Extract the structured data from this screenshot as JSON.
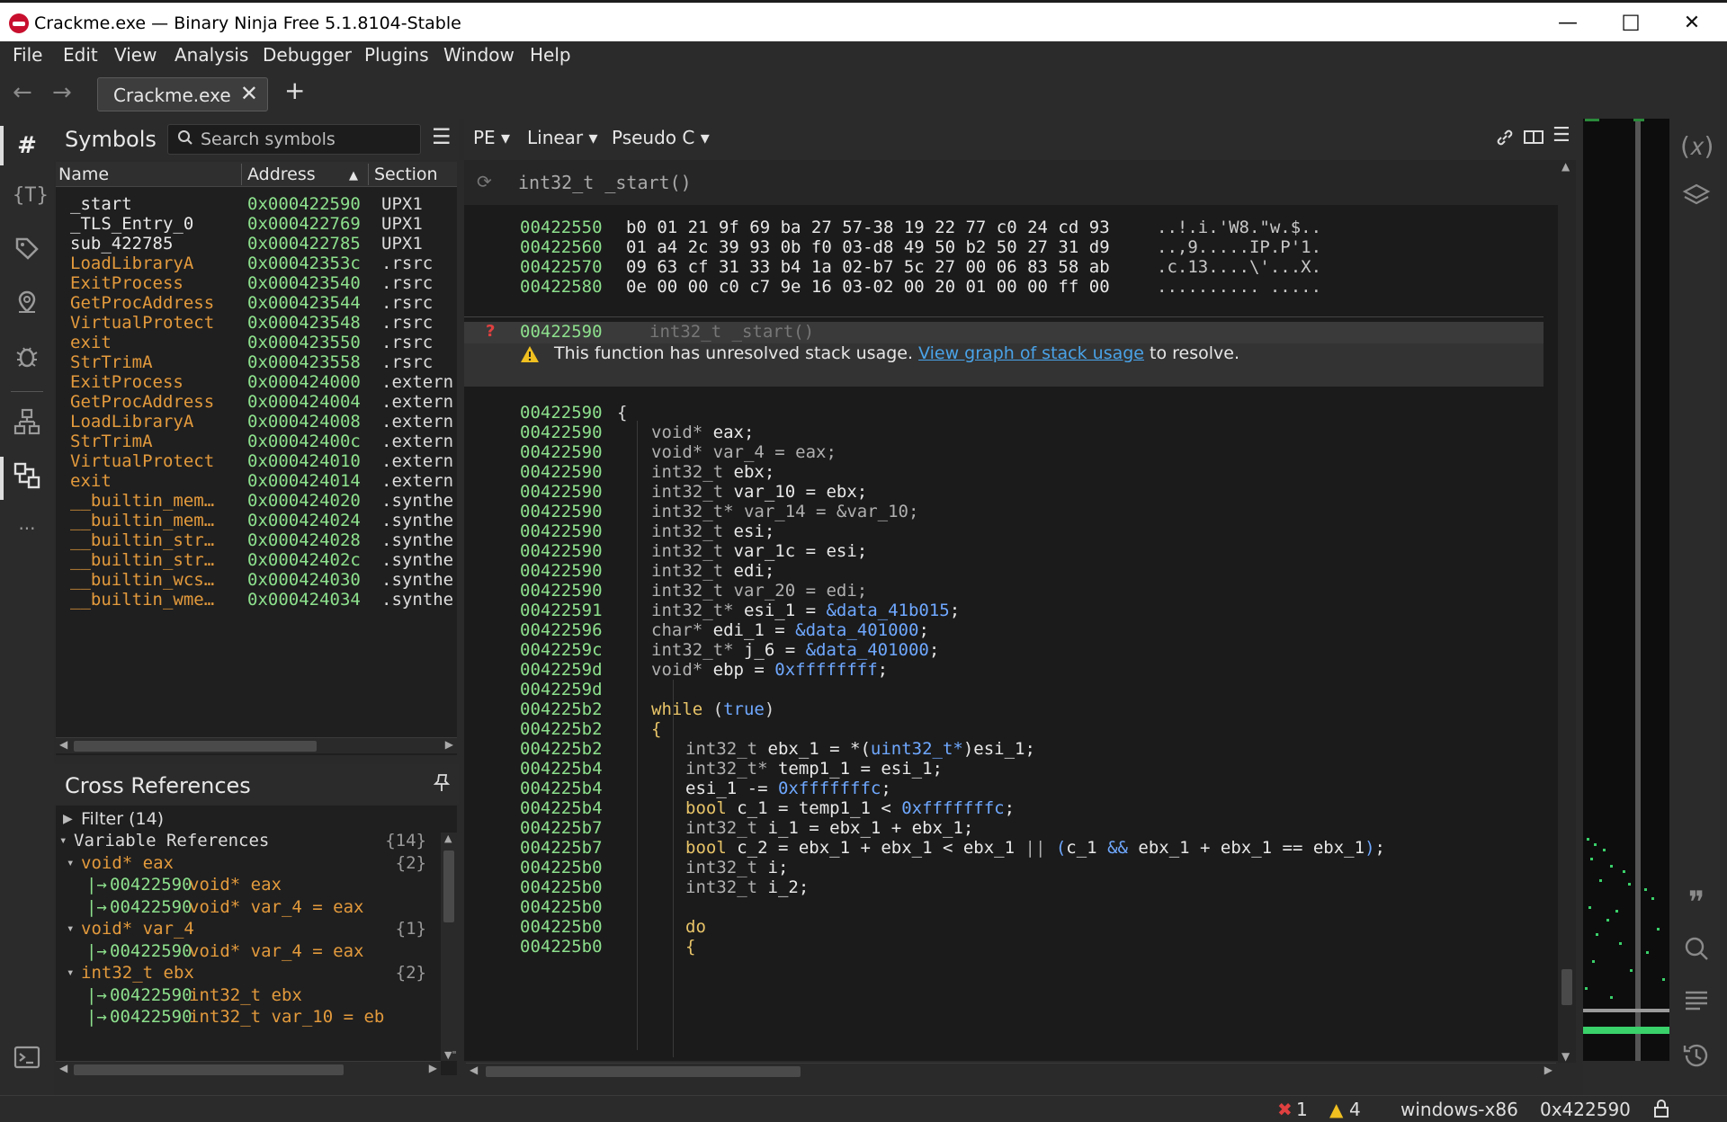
{
  "window": {
    "title": "Crackme.exe — Binary Ninja Free 5.1.8104-Stable",
    "minimize": "—",
    "maximize": "☐",
    "close": "✕"
  },
  "menu": [
    "File",
    "Edit",
    "View",
    "Analysis",
    "Debugger",
    "Plugins",
    "Window",
    "Help"
  ],
  "tabs": {
    "back": "←",
    "forward": "→",
    "active": "Crackme.exe",
    "close": "✕",
    "new": "+"
  },
  "symbols": {
    "title": "Symbols",
    "search_placeholder": "Search symbols",
    "columns": {
      "name": "Name",
      "address": "Address",
      "sort_indicator": "▲",
      "section": "Section"
    },
    "rows": [
      {
        "name": "_start",
        "address": "0x000422590",
        "section": "UPX1",
        "color": "#e8e8e8"
      },
      {
        "name": "_TLS_Entry_0",
        "address": "0x000422769",
        "section": "UPX1",
        "color": "#e8e8e8"
      },
      {
        "name": "sub_422785",
        "address": "0x000422785",
        "section": "UPX1",
        "color": "#e8e8e8"
      },
      {
        "name": "LoadLibraryA",
        "address": "0x00042353c",
        "section": ".rsrc",
        "color": "#e39a3c"
      },
      {
        "name": "ExitProcess",
        "address": "0x000423540",
        "section": ".rsrc",
        "color": "#e39a3c"
      },
      {
        "name": "GetProcAddress",
        "address": "0x000423544",
        "section": ".rsrc",
        "color": "#e39a3c"
      },
      {
        "name": "VirtualProtect",
        "address": "0x000423548",
        "section": ".rsrc",
        "color": "#e39a3c"
      },
      {
        "name": "exit",
        "address": "0x000423550",
        "section": ".rsrc",
        "color": "#e39a3c"
      },
      {
        "name": "StrTrimA",
        "address": "0x000423558",
        "section": ".rsrc",
        "color": "#e39a3c"
      },
      {
        "name": "ExitProcess",
        "address": "0x000424000",
        "section": ".extern",
        "color": "#e39a3c"
      },
      {
        "name": "GetProcAddress",
        "address": "0x000424004",
        "section": ".extern",
        "color": "#e39a3c"
      },
      {
        "name": "LoadLibraryA",
        "address": "0x000424008",
        "section": ".extern",
        "color": "#e39a3c"
      },
      {
        "name": "StrTrimA",
        "address": "0x00042400c",
        "section": ".extern",
        "color": "#e39a3c"
      },
      {
        "name": "VirtualProtect",
        "address": "0x000424010",
        "section": ".extern",
        "color": "#e39a3c"
      },
      {
        "name": "exit",
        "address": "0x000424014",
        "section": ".extern",
        "color": "#e39a3c"
      },
      {
        "name": "__builtin_mem…",
        "address": "0x000424020",
        "section": ".synthe",
        "color": "#e39a3c"
      },
      {
        "name": "__builtin_mem…",
        "address": "0x000424024",
        "section": ".synthe",
        "color": "#e39a3c"
      },
      {
        "name": "__builtin_str…",
        "address": "0x000424028",
        "section": ".synthe",
        "color": "#e39a3c"
      },
      {
        "name": "__builtin_str…",
        "address": "0x00042402c",
        "section": ".synthe",
        "color": "#e39a3c"
      },
      {
        "name": "__builtin_wcs…",
        "address": "0x000424030",
        "section": ".synthe",
        "color": "#e39a3c"
      },
      {
        "name": "__builtin_wme…",
        "address": "0x000424034",
        "section": ".synthe",
        "color": "#e39a3c"
      }
    ]
  },
  "xrefs": {
    "title": "Cross References",
    "filter": "Filter (14)",
    "rows": [
      {
        "indent": 0,
        "arrow": "▾",
        "text": "Variable References",
        "count": "{14}",
        "kind": "group"
      },
      {
        "indent": 1,
        "arrow": "▾",
        "text": "void* eax",
        "count": "{2}",
        "kind": "var"
      },
      {
        "indent": 2,
        "arrow": "|→",
        "addr": "00422590",
        "text": "void* eax",
        "count": "",
        "kind": "ref"
      },
      {
        "indent": 2,
        "arrow": "|→",
        "addr": "00422590",
        "text": "void* var_4 = eax",
        "count": "",
        "kind": "ref"
      },
      {
        "indent": 1,
        "arrow": "▾",
        "text": "void* var_4",
        "count": "{1}",
        "kind": "var"
      },
      {
        "indent": 2,
        "arrow": "|→",
        "addr": "00422590",
        "text": "void* var_4 = eax",
        "count": "",
        "kind": "ref"
      },
      {
        "indent": 1,
        "arrow": "▾",
        "text": "int32_t ebx",
        "count": "{2}",
        "kind": "var"
      },
      {
        "indent": 2,
        "arrow": "|→",
        "addr": "00422590",
        "text": "int32_t ebx",
        "count": "",
        "kind": "ref"
      },
      {
        "indent": 2,
        "arrow": "|→",
        "addr": "00422590",
        "text": "int32_t var_10 = eb",
        "count": "",
        "kind": "ref"
      }
    ]
  },
  "toolbar": {
    "pe": "PE ▾",
    "linear": "Linear ▾",
    "pseudo": "Pseudo C ▾"
  },
  "function_header": "int32_t _start()",
  "hex": [
    {
      "addr": "00422550",
      "bytes": "b0 01 21 9f 69 ba 27 57-38 19 22 77 c0 24 cd 93",
      "ascii": "..!.i.'W8.\"w.$.."
    },
    {
      "addr": "00422560",
      "bytes": "01 a4 2c 39 93 0b f0 03-d8 49 50 b2 50 27 31 d9",
      "ascii": "..,9.....IP.P'1."
    },
    {
      "addr": "00422570",
      "bytes": "09 63 cf 31 33 b4 1a 02-b7 5c 27 00 06 83 58 ab",
      "ascii": ".c.13....\\'...X."
    },
    {
      "addr": "00422580",
      "bytes": "0e 00 00 c0 c7 9e 16 03-02 00 20 01 00 00 ff 00",
      "ascii": ".......... ....."
    }
  ],
  "func_line": {
    "addr": "00422590",
    "sig": "int32_t _start()"
  },
  "warning": {
    "text": "This function has unresolved stack usage.",
    "link": "View graph of stack usage",
    "tail": "to resolve."
  },
  "code": [
    {
      "addr": "00422590",
      "indent": 0,
      "html": "<span class='op'>{</span>"
    },
    {
      "addr": "00422590",
      "indent": 1,
      "html": "<span class='ty'>void* </span><span class='vr'>eax;</span>"
    },
    {
      "addr": "00422590",
      "indent": 1,
      "html": "<span class='ty'>void* var_4 = eax;</span>"
    },
    {
      "addr": "00422590",
      "indent": 1,
      "html": "<span class='ty'>int32_t </span><span class='vr'>ebx;</span>"
    },
    {
      "addr": "00422590",
      "indent": 1,
      "html": "<span class='ty'>int32_t </span><span class='vr'>var_10 = ebx;</span>"
    },
    {
      "addr": "00422590",
      "indent": 1,
      "html": "<span class='ty'>int32_t* var_14 = &amp;var_10;</span>"
    },
    {
      "addr": "00422590",
      "indent": 1,
      "html": "<span class='ty'>int32_t </span><span class='vr'>esi;</span>"
    },
    {
      "addr": "00422590",
      "indent": 1,
      "html": "<span class='ty'>int32_t </span><span class='vr'>var_1c = esi;</span>"
    },
    {
      "addr": "00422590",
      "indent": 1,
      "html": "<span class='ty'>int32_t </span><span class='vr'>edi;</span>"
    },
    {
      "addr": "00422590",
      "indent": 1,
      "html": "<span class='ty'>int32_t var_20 = edi;</span>"
    },
    {
      "addr": "00422591",
      "indent": 1,
      "html": "<span class='ty'>int32_t* </span><span class='vr'>esi_1 = </span><span class='nm'>&amp;data_41b015</span><span class='vr'>;</span>"
    },
    {
      "addr": "00422596",
      "indent": 1,
      "html": "<span class='ty'>char* </span><span class='vr'>edi_1 = </span><span class='nm'>&amp;data_401000</span><span class='vr'>;</span>"
    },
    {
      "addr": "0042259c",
      "indent": 1,
      "html": "<span class='ty'>int32_t* </span><span class='vr'>j_6 = </span><span class='nm'>&amp;data_401000</span><span class='vr'>;</span>"
    },
    {
      "addr": "0042259d",
      "indent": 1,
      "html": "<span class='ty'>void* </span><span class='vr'>ebp = </span><span class='nm'>0xffffffff</span><span class='vr'>;</span>"
    },
    {
      "addr": "0042259d",
      "indent": 1,
      "html": ""
    },
    {
      "addr": "004225b2",
      "indent": 1,
      "html": "<span class='kw'>while </span><span class='op'>(</span><span class='nm'>true</span><span class='op'>)</span>"
    },
    {
      "addr": "004225b2",
      "indent": 1,
      "html": "<span class='kw'>{</span>"
    },
    {
      "addr": "004225b2",
      "indent": 2,
      "html": "<span class='ty'>int32_t </span><span class='vr'>ebx_1 = *(</span><span class='nm'>uint32_t*</span><span class='vr'>)esi_1;</span>"
    },
    {
      "addr": "004225b4",
      "indent": 2,
      "html": "<span class='ty'>int32_t* </span><span class='vr'>temp1_1 = esi_1;</span>"
    },
    {
      "addr": "004225b4",
      "indent": 2,
      "html": "<span class='vr'>esi_1 -= </span><span class='nm'>0xfffffffc</span><span class='vr'>;</span>"
    },
    {
      "addr": "004225b4",
      "indent": 2,
      "html": "<span class='kw'>bool </span><span class='vr'>c_1 = temp1_1 &lt; </span><span class='nm'>0xfffffffc</span><span class='vr'>;</span>"
    },
    {
      "addr": "004225b7",
      "indent": 2,
      "html": "<span class='ty'>int32_t </span><span class='vr'>i_1 = ebx_1 + ebx_1;</span>"
    },
    {
      "addr": "004225b7",
      "indent": 2,
      "html": "<span class='kw'>bool </span><span class='vr'>c_2 = ebx_1 + ebx_1 &lt; ebx_1 </span><span class='ty'>||</span><span class='vr'> </span><span class='nm'>(</span><span class='vr'>c_1 </span><span class='nm'>&amp;&amp;</span><span class='vr'> ebx_1 + ebx_1 == ebx_1</span><span class='nm'>)</span><span class='vr'>;</span>"
    },
    {
      "addr": "004225b0",
      "indent": 2,
      "html": "<span class='ty'>int32_t </span><span class='vr'>i;</span>"
    },
    {
      "addr": "004225b0",
      "indent": 2,
      "html": "<span class='ty'>int32_t </span><span class='vr'>i_2;</span>"
    },
    {
      "addr": "004225b0",
      "indent": 2,
      "html": ""
    },
    {
      "addr": "004225b0",
      "indent": 2,
      "html": "<span class='kw'>do</span>"
    },
    {
      "addr": "004225b0",
      "indent": 2,
      "html": "<span class='kw'>{</span>"
    }
  ],
  "status": {
    "errors": "1",
    "warnings": "4",
    "platform": "windows-x86",
    "address": "0x422590"
  }
}
